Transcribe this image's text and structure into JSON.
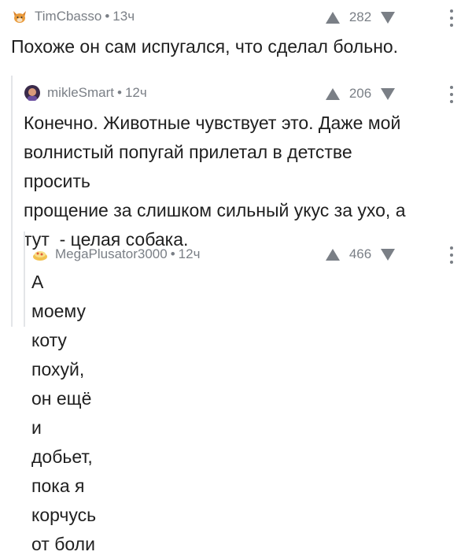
{
  "comments": [
    {
      "author": "TimCbasso",
      "time": "13ч",
      "votes": "282",
      "text": "Похоже он сам испугался, что сделал больно.",
      "avatar_icon": "fox-avatar-icon"
    },
    {
      "author": "mikleSmart",
      "time": "12ч",
      "votes": "206",
      "text_lines": [
        "Конечно. Животные чувствует это. Даже мой",
        "волнистый попугай прилетал в детстве просить",
        "прощение за слишком сильный укус за ухо, а",
        "тут  - целая собака."
      ],
      "avatar_icon": "person-avatar-icon"
    },
    {
      "author": "MegaPlusator3000",
      "time": "12ч",
      "votes": "466",
      "text_lines": [
        "А моему коту похуй, он ещё и добьет, пока я",
        "корчусь от боли"
      ],
      "avatar_icon": "food-avatar-icon"
    }
  ],
  "separator": "•",
  "colors": {
    "text": "#1f1f1f",
    "meta": "#7a7f86",
    "thread_line": "#e3e5e8"
  }
}
